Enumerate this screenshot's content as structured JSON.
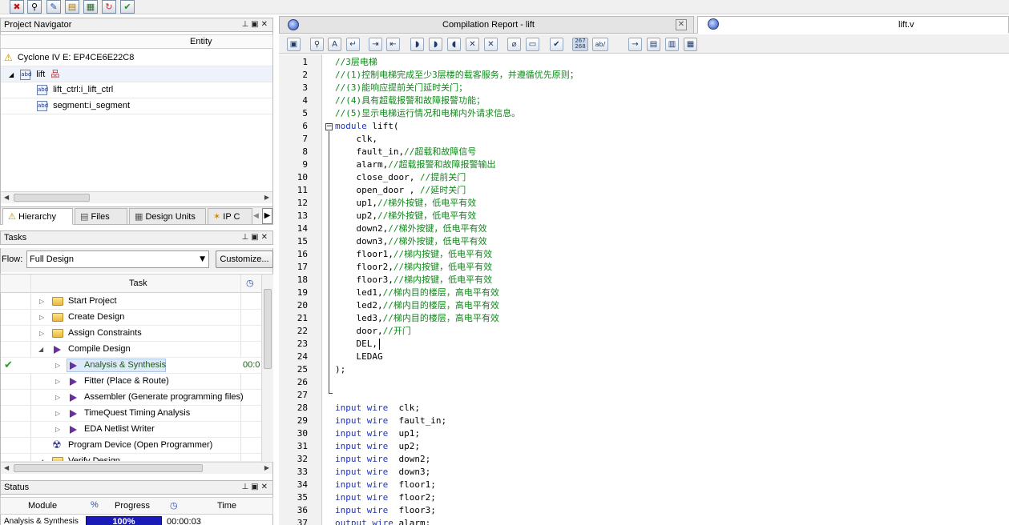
{
  "toolbar": {
    "icons": [
      "stop-icon",
      "binoculars-icon",
      "pencil-icon",
      "assignments-icon",
      "chip-planner-icon",
      "compile-icon",
      "check-icon"
    ]
  },
  "project_navigator": {
    "title": "Project Navigator",
    "column_header": "Entity",
    "device": "Cyclone IV E: EP4CE6E22C8",
    "top_entity": "lift",
    "children": [
      "lift_ctrl:i_lift_ctrl",
      "segment:i_segment"
    ],
    "tabs": [
      "Hierarchy",
      "Files",
      "Design Units",
      "IP C"
    ]
  },
  "tasks": {
    "title": "Tasks",
    "flow_label": "Flow:",
    "flow_value": "Full Design",
    "customize_label": "Customize...",
    "column_task": "Task",
    "rows": [
      {
        "label": "Start Project",
        "time": ""
      },
      {
        "label": "Create Design",
        "time": ""
      },
      {
        "label": "Assign Constraints",
        "time": ""
      },
      {
        "label": "Compile Design",
        "time": ""
      },
      {
        "label": "Analysis & Synthesis",
        "time": "00:0"
      },
      {
        "label": "Fitter (Place & Route)",
        "time": ""
      },
      {
        "label": "Assembler (Generate programming files)",
        "time": ""
      },
      {
        "label": "TimeQuest Timing Analysis",
        "time": ""
      },
      {
        "label": "EDA Netlist Writer",
        "time": ""
      },
      {
        "label": "Program Device (Open Programmer)",
        "time": ""
      },
      {
        "label": "Verify Design",
        "time": ""
      }
    ]
  },
  "status": {
    "title": "Status",
    "columns": [
      "Module",
      "%",
      "Progress",
      "Time"
    ],
    "row": {
      "module": "Analysis & Synthesis",
      "progress_text": "100%",
      "progress": 100,
      "time": "00:00:03"
    }
  },
  "editor": {
    "tabs": [
      {
        "label": "Compilation Report - lift",
        "active": false
      },
      {
        "label": "lift.v",
        "active": true
      }
    ],
    "lines": [
      {
        "n": "1",
        "text": "//3层电梯",
        "type": "comment"
      },
      {
        "n": "2",
        "text": "//(1)控制电梯完成至少3层楼的载客服务，并遵循优先原则；",
        "type": "comment"
      },
      {
        "n": "3",
        "text": "//(3)能响应提前关门延时关门；",
        "type": "comment"
      },
      {
        "n": "4",
        "text": "//(4)具有超载报警和故障报警功能；",
        "type": "comment"
      },
      {
        "n": "5",
        "text": "//(5)显示电梯运行情况和电梯内外请求信息。",
        "type": "comment"
      },
      {
        "n": "6",
        "pre": "",
        "kw": "module",
        "text": " lift(",
        "cmt": ""
      },
      {
        "n": "7",
        "pre": "",
        "kw": "",
        "text": "    clk,",
        "cmt": ""
      },
      {
        "n": "8",
        "text": "    fault_in,",
        "cmt": "//超载和故障信号"
      },
      {
        "n": "9",
        "text": "    alarm,",
        "cmt": "//超载报警和故障报警输出"
      },
      {
        "n": "10",
        "text": "    close_door, ",
        "cmt": "//提前关门"
      },
      {
        "n": "11",
        "text": "    open_door , ",
        "cmt": "//延时关门"
      },
      {
        "n": "12",
        "text": "    up1,",
        "cmt": "//梯外按键，低电平有效"
      },
      {
        "n": "13",
        "text": "    up2,",
        "cmt": "//梯外按键，低电平有效"
      },
      {
        "n": "14",
        "text": "    down2,",
        "cmt": "//梯外按键，低电平有效"
      },
      {
        "n": "15",
        "text": "    down3,",
        "cmt": "//梯外按键，低电平有效"
      },
      {
        "n": "16",
        "text": "    floor1,",
        "cmt": "//梯内按键，低电平有效"
      },
      {
        "n": "17",
        "text": "    floor2,",
        "cmt": "//梯内按键，低电平有效"
      },
      {
        "n": "18",
        "text": "    floor3,",
        "cmt": "//梯内按键，低电平有效"
      },
      {
        "n": "19",
        "text": "    led1,",
        "cmt": "//梯内目的楼层，高电平有效"
      },
      {
        "n": "20",
        "text": "    led2,",
        "cmt": "//梯内目的楼层，高电平有效"
      },
      {
        "n": "21",
        "text": "    led3,",
        "cmt": "//梯内目的楼层，高电平有效"
      },
      {
        "n": "22",
        "text": "    door,",
        "cmt": "//开门"
      },
      {
        "n": "23",
        "text": "    DEL,",
        "cmt": ""
      },
      {
        "n": "24",
        "text": "    LEDAG",
        "cmt": ""
      },
      {
        "n": "25",
        "text": ");",
        "cmt": ""
      },
      {
        "n": "26",
        "text": "",
        "cmt": ""
      },
      {
        "n": "27",
        "text": "",
        "cmt": ""
      },
      {
        "n": "28",
        "kw": "input wire",
        "text": "  clk;"
      },
      {
        "n": "29",
        "kw": "input wire",
        "text": "  fault_in;"
      },
      {
        "n": "30",
        "kw": "input wire",
        "text": "  up1;"
      },
      {
        "n": "31",
        "kw": "input wire",
        "text": "  up2;"
      },
      {
        "n": "32",
        "kw": "input wire",
        "text": "  down2;"
      },
      {
        "n": "33",
        "kw": "input wire",
        "text": "  down3;"
      },
      {
        "n": "34",
        "kw": "input wire",
        "text": "  floor1;"
      },
      {
        "n": "35",
        "kw": "input wire",
        "text": "  floor2;"
      },
      {
        "n": "36",
        "kw": "input wire",
        "text": "  floor3;"
      },
      {
        "n": "37",
        "kw": "output wire",
        "text": " alarm;"
      }
    ]
  },
  "colors": {
    "comment": "#11881b",
    "keyword": "#1c34c4",
    "progress": "#1a1ab8"
  }
}
